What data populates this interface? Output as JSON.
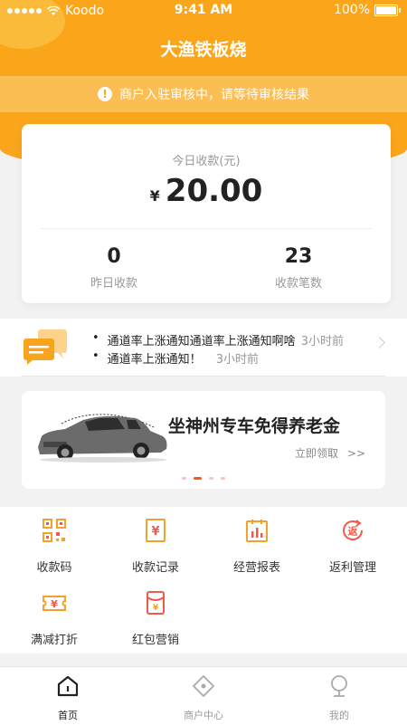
{
  "status_bar": {
    "carrier": "Koodo",
    "time": "9:41 AM",
    "battery": "100%"
  },
  "header": {
    "title": "大渔铁板烧"
  },
  "notice": {
    "text": "商户入驻审核中，请等待审核结果"
  },
  "summary": {
    "today_label": "今日收款(元)",
    "currency": "¥",
    "today_amount": "20.00",
    "yesterday_value": "0",
    "yesterday_label": "昨日收款",
    "count_value": "23",
    "count_label": "收款笔数"
  },
  "messages": [
    {
      "text": "通道率上涨通知通道率上涨通知啊啥",
      "time": "3小时前"
    },
    {
      "text": "通道率上涨通知！",
      "time": "3小时前"
    }
  ],
  "banner": {
    "title": "坐神州专车免得养老金",
    "link": "立即领取",
    "link_arrow": ">>"
  },
  "shortcuts": [
    {
      "label": "收款码",
      "icon": "qr-code-icon"
    },
    {
      "label": "收款记录",
      "icon": "receipt-icon"
    },
    {
      "label": "经营报表",
      "icon": "report-icon"
    },
    {
      "label": "返利管理",
      "icon": "rebate-icon"
    },
    {
      "label": "满减打折",
      "icon": "discount-ticket-icon"
    },
    {
      "label": "红包营销",
      "icon": "red-packet-icon"
    }
  ],
  "tabs": [
    {
      "label": "首页",
      "icon": "home-icon",
      "active": true
    },
    {
      "label": "商户中心",
      "icon": "merchant-center-icon",
      "active": false
    },
    {
      "label": "我的",
      "icon": "profile-icon",
      "active": false
    }
  ],
  "colors": {
    "brand": "#fba51b",
    "accent": "#f05a28",
    "icon_orange": "#f4a02b",
    "icon_red": "#f15a4a"
  }
}
